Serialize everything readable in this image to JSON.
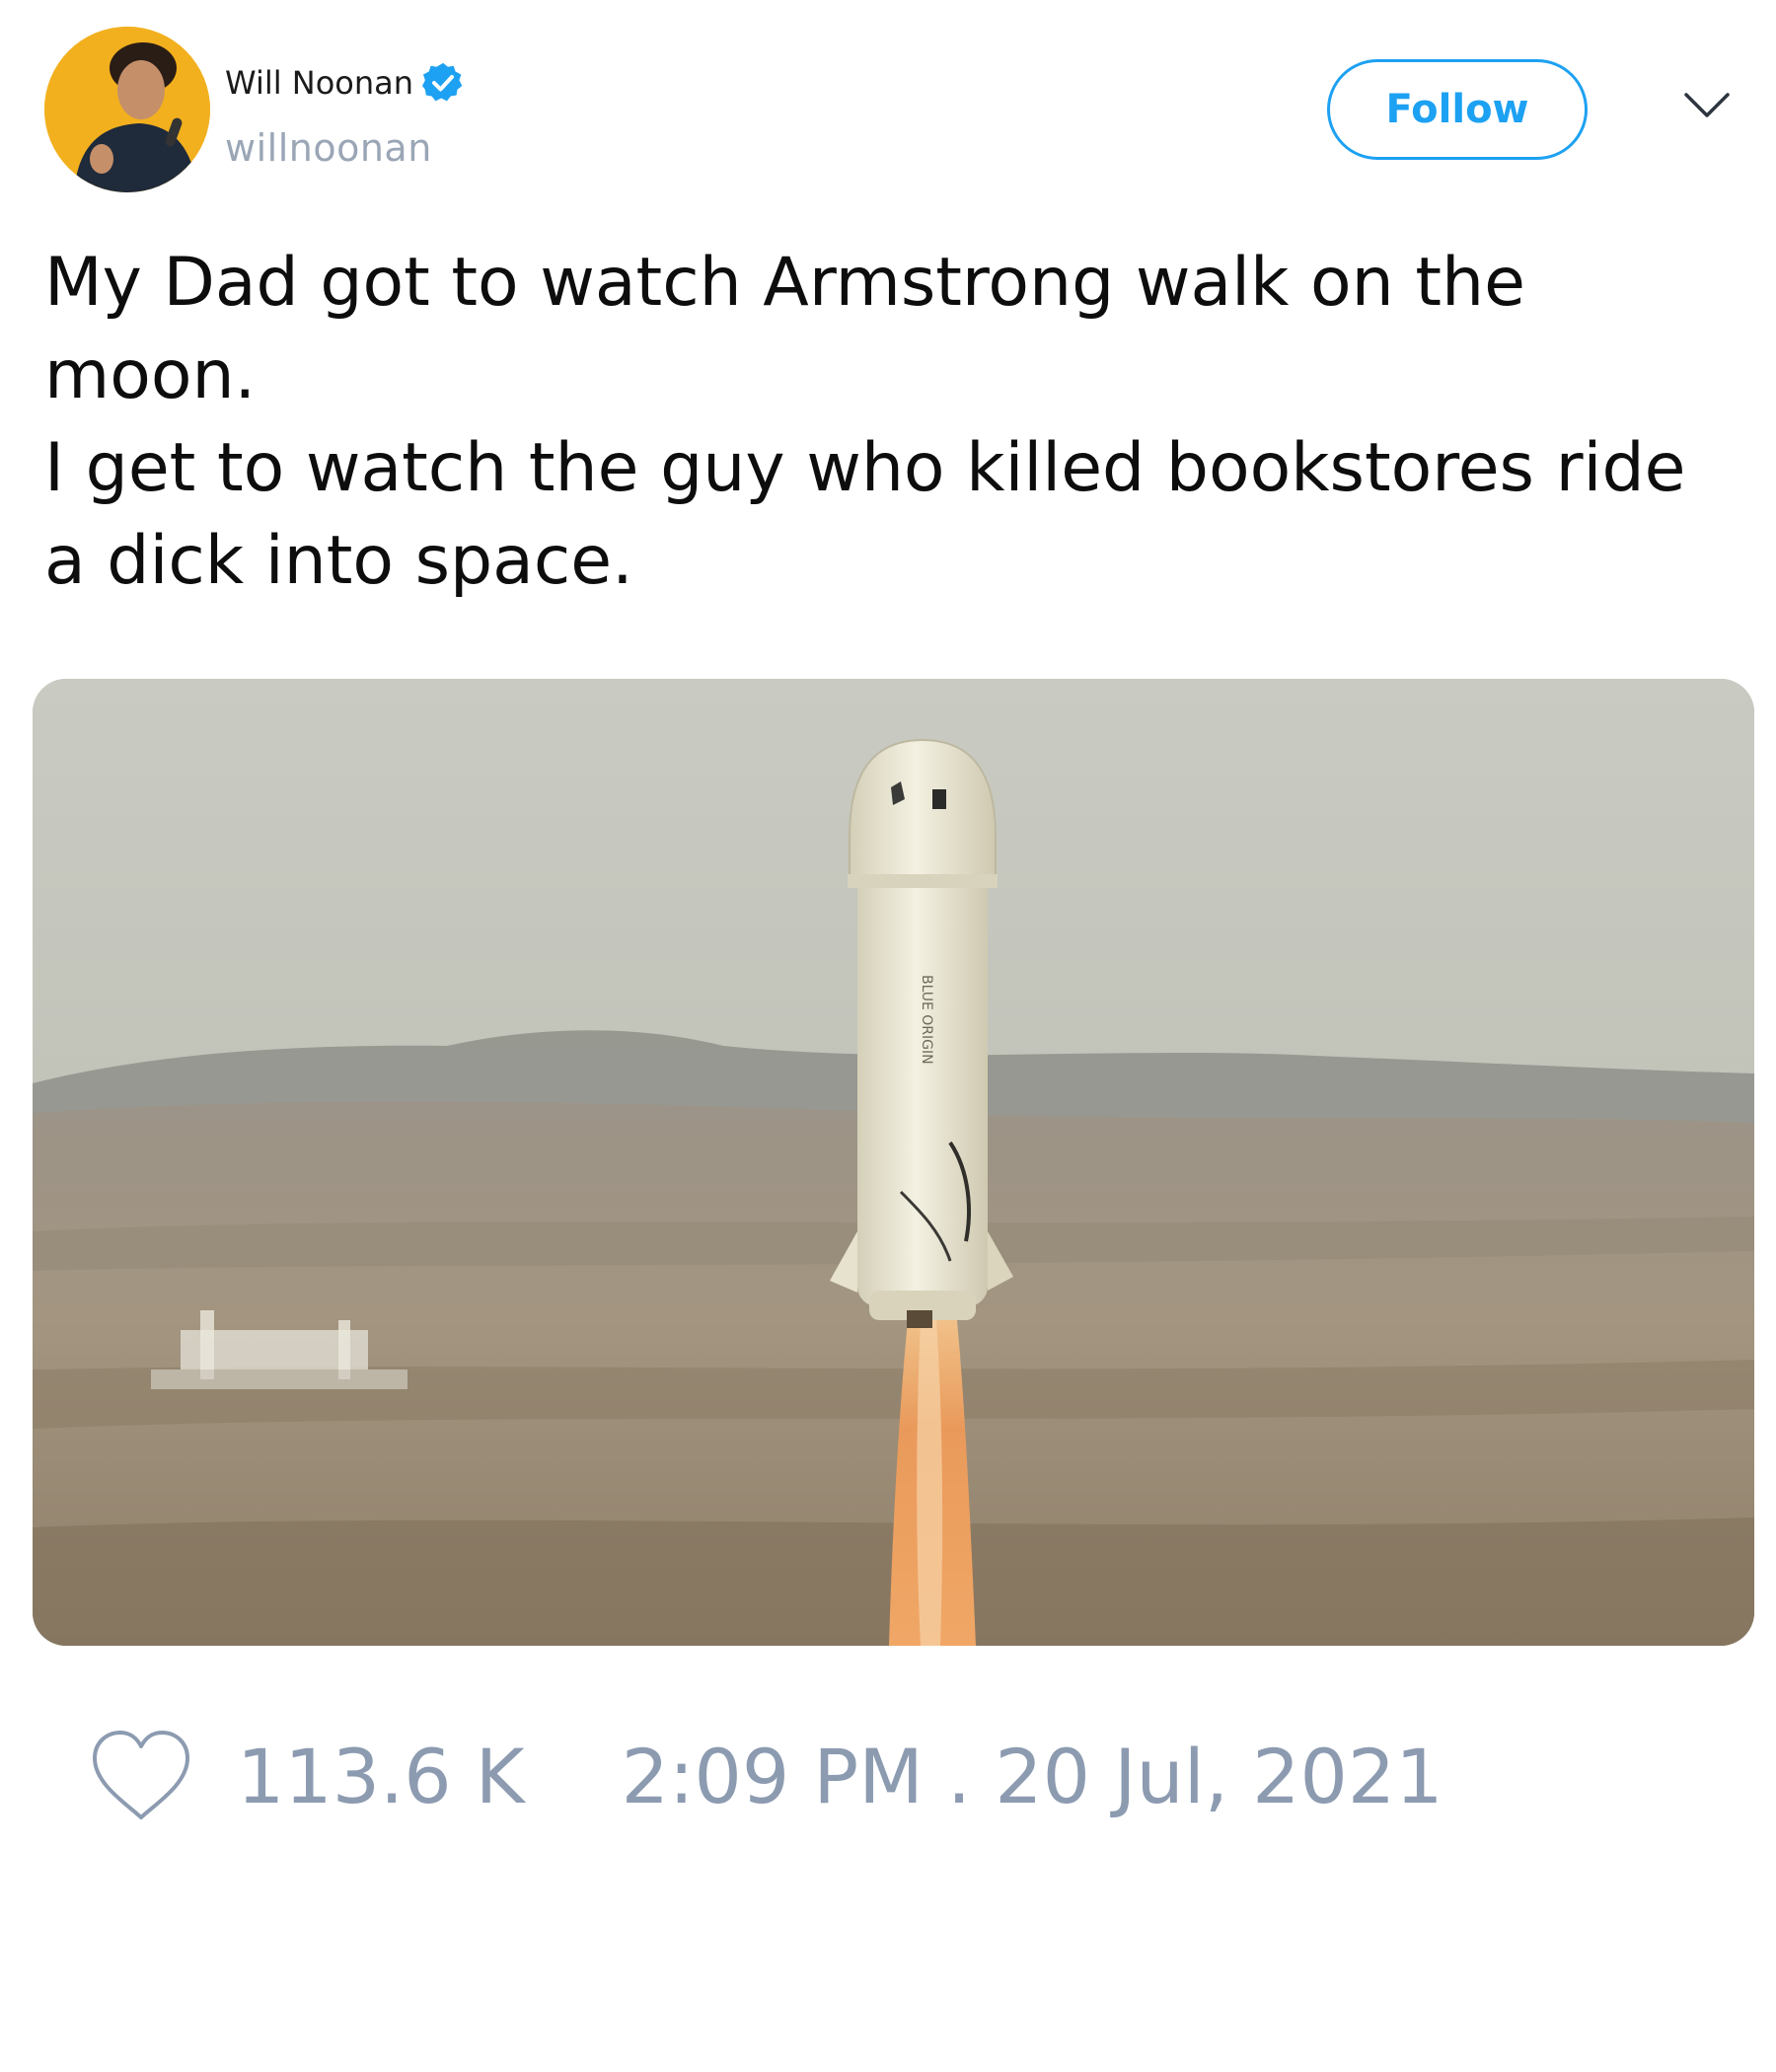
{
  "author": {
    "display_name": "Will Noonan",
    "handle": "willnoonan",
    "verified": true,
    "avatar_icon": "profile-photo"
  },
  "follow_label": "Follow",
  "menu_icon": "chevron-down-icon",
  "tweet": {
    "lines": [
      "My Dad got to watch Armstrong walk on the",
      "moon.",
      "I get to watch the guy who killed bookstores ride",
      "a dick into space."
    ]
  },
  "media": {
    "kind": "photo",
    "subject": "rocket-launch"
  },
  "footer": {
    "like_count": "113.6 K",
    "timestamp": "2:09 PM . 20 Jul, 2021"
  },
  "colors": {
    "accent": "#1da1f2",
    "muted": "#8c9bb0",
    "handle": "#9aa6b6"
  }
}
